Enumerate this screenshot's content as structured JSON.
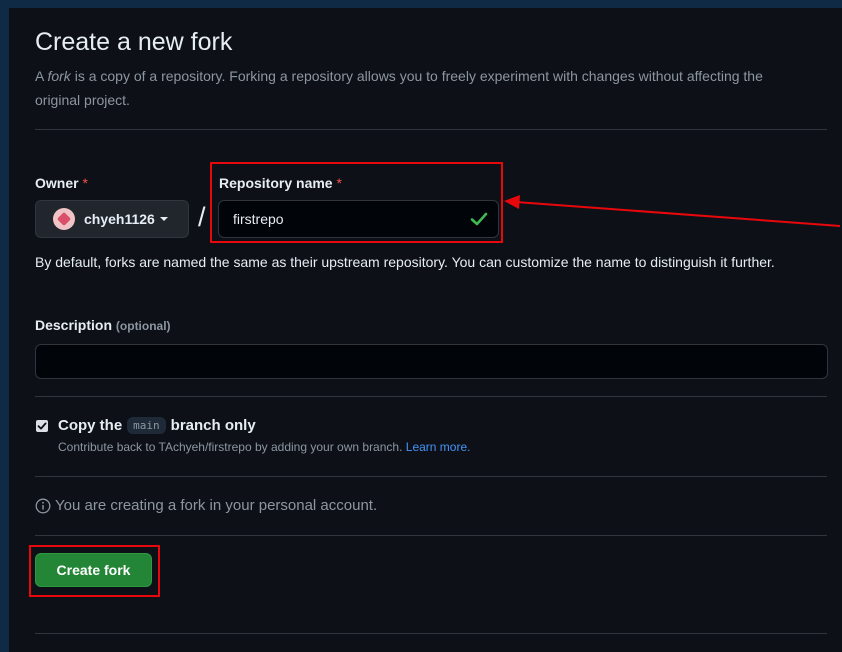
{
  "header": {
    "title": "Create a new fork",
    "subtitle_em": "fork",
    "subtitle_pre": "A ",
    "subtitle_post": " is a copy of a repository. Forking a repository allows you to freely experiment with changes without affecting the original project."
  },
  "owner": {
    "label": "Owner",
    "required_mark": "*",
    "name": "chyeh1126"
  },
  "repository": {
    "label": "Repository name",
    "required_mark": "*",
    "separator": "/",
    "value": "firstrepo"
  },
  "hint": "By default, forks are named the same as their upstream repository. You can customize the name to distinguish it further.",
  "description": {
    "label": "Description",
    "optional": "(optional)",
    "value": ""
  },
  "copy_branch": {
    "checked": true,
    "label_pre": "Copy the",
    "branch": "main",
    "label_post": "branch only",
    "sub_text": "Contribute back to TAchyeh/firstrepo by adding your own branch.",
    "learn_more": "Learn more."
  },
  "info": "You are creating a fork in your personal account.",
  "create_button": "Create fork",
  "colors": {
    "background": "#0d1117",
    "accent_green": "#238636",
    "annotation_red": "#e8070b",
    "link": "#4493f8"
  }
}
